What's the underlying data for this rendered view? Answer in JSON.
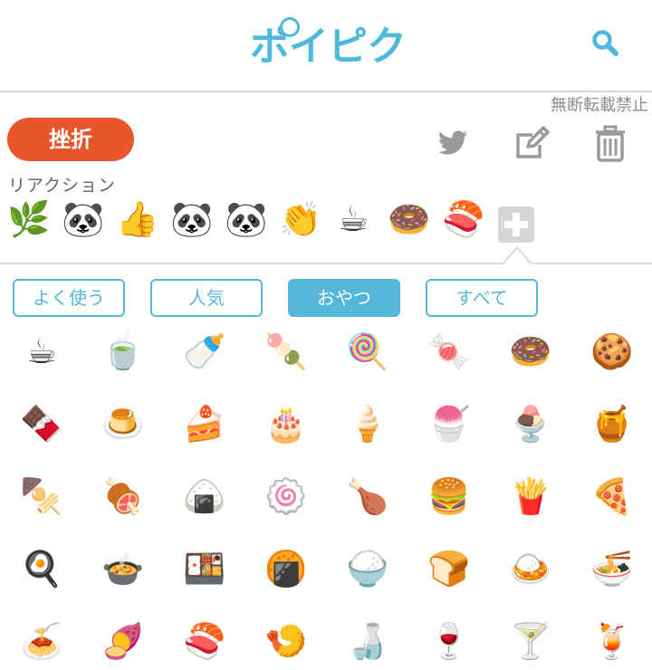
{
  "header": {
    "logo_text": "ポイピク"
  },
  "notice": "無断転載禁止",
  "tag_button": "挫折",
  "actions": [
    {
      "name": "twitter-share-button",
      "icon": "twitter-bird-icon"
    },
    {
      "name": "edit-button",
      "icon": "pencil-square-icon"
    },
    {
      "name": "delete-button",
      "icon": "trash-icon"
    }
  ],
  "reactions": {
    "title": "リアクション",
    "items": [
      "🌿",
      "🐼",
      "👍",
      "🐼",
      "🐼",
      "👏",
      "☕",
      "🍩",
      "🍣"
    ]
  },
  "tabs": [
    {
      "label": "よく使う",
      "active": false
    },
    {
      "label": "人気",
      "active": false
    },
    {
      "label": "おやつ",
      "active": true
    },
    {
      "label": "すべて",
      "active": false
    }
  ],
  "emoji_grid": [
    "☕",
    "🍵",
    "🍼",
    "🍡",
    "🍭",
    "🍬",
    "🍩",
    "🍪",
    "🍫",
    "🍮",
    "🍰",
    "🎂",
    "🍦",
    "🍧",
    "🍨",
    "🍯",
    "🍢",
    "🍖",
    "🍙",
    "🍥",
    "🍗",
    "🍔",
    "🍟",
    "🍕",
    "🍳",
    "🍲",
    "🍱",
    "🍘",
    "🍚",
    "🍞",
    "🍛",
    "🍜",
    "🍝",
    "🍠",
    "🍣",
    "🍤",
    "🍶",
    "🍷",
    "🍸",
    "🍹"
  ]
}
